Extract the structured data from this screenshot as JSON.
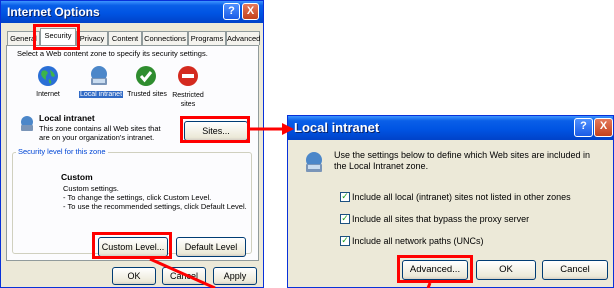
{
  "internet_options": {
    "title": "Internet Options",
    "help": "?",
    "close": "X",
    "tabs": [
      "General",
      "Security",
      "Privacy",
      "Content",
      "Connections",
      "Programs",
      "Advanced"
    ],
    "instruction": "Select a Web content zone to specify its security settings.",
    "zones": [
      "Internet",
      "Local intranet",
      "Trusted sites",
      "Restricted sites"
    ],
    "zone_heading": "Local intranet",
    "zone_desc_1": "This zone contains all Web sites that",
    "zone_desc_2": "are on your organization's intranet.",
    "sites_button": "Sites...",
    "security_level_legend": "Security level for this zone",
    "level_name": "Custom",
    "level_line_1": "Custom settings.",
    "level_line_2": "- To change the settings, click Custom Level.",
    "level_line_3": "- To use the recommended settings, click Default Level.",
    "custom_level_button": "Custom Level...",
    "default_level_button": "Default Level",
    "ok_button": "OK",
    "cancel_button": "Cancel",
    "apply_button": "Apply"
  },
  "local_intranet": {
    "title": "Local intranet",
    "help": "?",
    "close": "X",
    "description_1": "Use the settings below to define which Web sites are included in",
    "description_2": "the Local Intranet zone.",
    "options": [
      {
        "label": "Include all local (intranet) sites not listed in other zones",
        "checked": true
      },
      {
        "label": "Include all sites that bypass the proxy server",
        "checked": true
      },
      {
        "label": "Include all network paths (UNCs)",
        "checked": true
      }
    ],
    "advanced_button": "Advanced...",
    "ok_button": "OK",
    "cancel_button": "Cancel"
  },
  "colors": {
    "highlight": "#ff0000",
    "titlebar": "#0054e3",
    "dialog_bg": "#ece9d8"
  }
}
